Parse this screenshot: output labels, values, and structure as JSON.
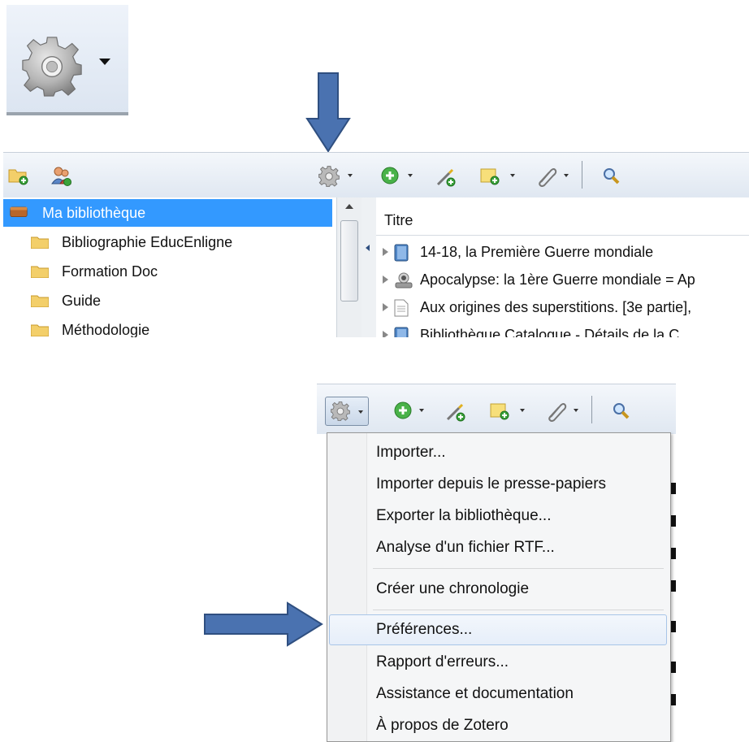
{
  "top_button": {
    "icon": "gear-icon",
    "caret": "dropdown-caret"
  },
  "toolbar": {
    "icons": [
      "new-collection-icon",
      "new-group-icon",
      "actions-gear-icon",
      "new-item-icon",
      "new-note-from-url-icon",
      "new-note-icon",
      "attachment-icon",
      "search-icon"
    ]
  },
  "library": {
    "items": [
      {
        "label": "Ma bibliothèque",
        "selected": true
      },
      {
        "label": "Bibliographie EducEnligne"
      },
      {
        "label": "Formation Doc"
      },
      {
        "label": "Guide"
      },
      {
        "label": "Méthodologie"
      }
    ]
  },
  "items_pane": {
    "column_header": "Titre",
    "rows": [
      {
        "title": "14-18, la Première Guerre mondiale",
        "icon": "book-icon"
      },
      {
        "title": "Apocalypse: la 1ère Guerre mondiale = Ap",
        "icon": "video-icon"
      },
      {
        "title": "Aux origines des superstitions. [3e partie],",
        "icon": "document-icon"
      },
      {
        "title": "Bibliothèque Catalogue - Détails de la C",
        "icon": "book-icon"
      }
    ]
  },
  "menu": {
    "groups": [
      [
        "Importer...",
        "Importer depuis le presse-papiers",
        "Exporter la bibliothèque...",
        "Analyse d'un fichier RTF..."
      ],
      [
        "Créer une chronologie"
      ],
      [
        "Préférences...",
        "Rapport d'erreurs...",
        "Assistance et documentation",
        "À propos de Zotero"
      ]
    ],
    "highlighted": "Préférences..."
  },
  "colors": {
    "selection": "#3399ff",
    "arrow": "#4a72b0",
    "toolbar_top": "#f4f7fb",
    "toolbar_bottom": "#dfe7f1"
  }
}
